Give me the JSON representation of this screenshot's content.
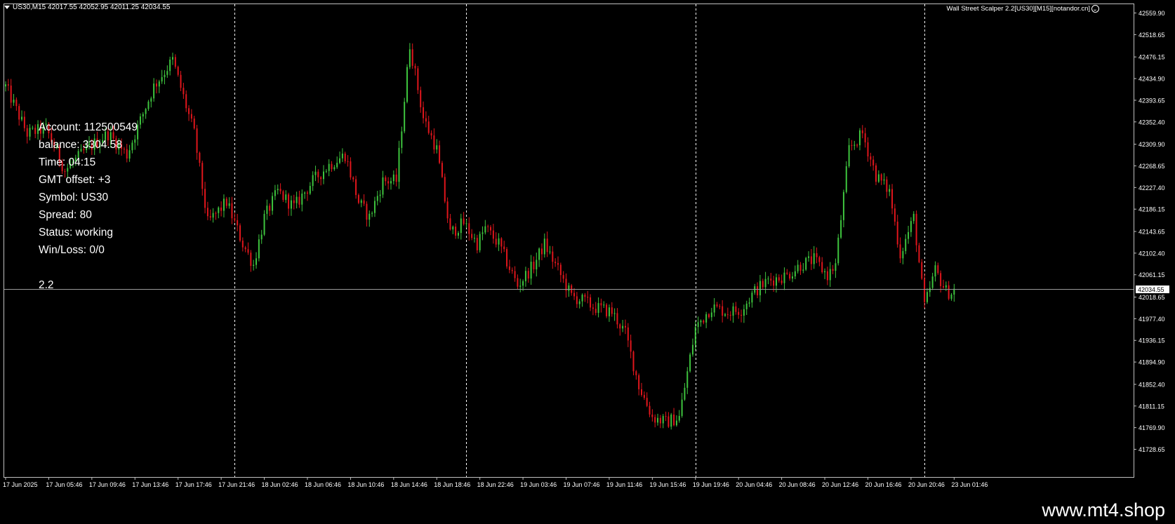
{
  "header": {
    "symbol_info": "US30,M15  42017.55 42052.95 42011.25 42034.55"
  },
  "expert": {
    "label": "Wall Street Scalper 2.2[US30][M15][notandor.cn]"
  },
  "hud": {
    "account": "Account: 112500549",
    "balance": "balance: 3304.58",
    "time": "Time: 04:15",
    "gmt": "GMT offset: +3",
    "symbol": "Symbol: US30",
    "spread": "Spread: 80",
    "status": "Status: working",
    "winloss": "Win/Loss: 0/0",
    "version": "2.2"
  },
  "footer": {
    "brand": "www.mt4.shop"
  },
  "colors": {
    "bull": "#3ec43e",
    "bear": "#e0161c",
    "grid": "#ffffff",
    "background": "#000000"
  },
  "chart_data": {
    "type": "candlestick",
    "ylim": [
      41728.65,
      42559.9
    ],
    "y_ticks": [
      42559.9,
      42518.65,
      42476.15,
      42434.9,
      42393.65,
      42352.4,
      42309.9,
      42268.65,
      42227.4,
      42186.15,
      42143.65,
      42102.4,
      42061.15,
      42018.65,
      41977.4,
      41936.15,
      41894.9,
      41852.4,
      41811.15,
      41769.9,
      41728.65
    ],
    "y_tick_labels": [
      "42559.90",
      "42518.65",
      "42476.15",
      "42434.90",
      "42393.65",
      "42352.40",
      "42309.90",
      "42268.65",
      "42227.40",
      "42186.15",
      "42143.65",
      "42102.40",
      "42061.15",
      "42018.65",
      "41977.40",
      "41936.15",
      "41894.90",
      "41852.40",
      "41811.15",
      "41769.90",
      "41728.65"
    ],
    "current_price": 42034.55,
    "current_price_label": "42034.55",
    "x_tick_labels": [
      "17 Jun 2025",
      "17 Jun 05:46",
      "17 Jun 09:46",
      "17 Jun 13:46",
      "17 Jun 17:46",
      "17 Jun 21:46",
      "18 Jun 02:46",
      "18 Jun 06:46",
      "18 Jun 10:46",
      "18 Jun 14:46",
      "18 Jun 18:46",
      "18 Jun 22:46",
      "19 Jun 03:46",
      "19 Jun 07:46",
      "19 Jun 11:46",
      "19 Jun 15:46",
      "19 Jun 19:46",
      "20 Jun 04:46",
      "20 Jun 08:46",
      "20 Jun 12:46",
      "20 Jun 16:46",
      "20 Jun 20:46",
      "23 Jun 01:46"
    ],
    "bars_total": 448,
    "period_separators": [
      85,
      171,
      256,
      341
    ],
    "anchors": [
      [
        0,
        42420
      ],
      [
        8,
        42330
      ],
      [
        15,
        42340
      ],
      [
        22,
        42260
      ],
      [
        30,
        42300
      ],
      [
        38,
        42330
      ],
      [
        45,
        42290
      ],
      [
        55,
        42420
      ],
      [
        62,
        42470
      ],
      [
        70,
        42330
      ],
      [
        75,
        42160
      ],
      [
        82,
        42200
      ],
      [
        88,
        42120
      ],
      [
        92,
        42080
      ],
      [
        96,
        42170
      ],
      [
        101,
        42220
      ],
      [
        107,
        42190
      ],
      [
        114,
        42240
      ],
      [
        120,
        42270
      ],
      [
        126,
        42290
      ],
      [
        131,
        42200
      ],
      [
        135,
        42170
      ],
      [
        140,
        42240
      ],
      [
        145,
        42240
      ],
      [
        150,
        42500
      ],
      [
        155,
        42360
      ],
      [
        160,
        42300
      ],
      [
        165,
        42140
      ],
      [
        170,
        42160
      ],
      [
        175,
        42120
      ],
      [
        178,
        42150
      ],
      [
        183,
        42120
      ],
      [
        190,
        42040
      ],
      [
        196,
        42080
      ],
      [
        200,
        42120
      ],
      [
        205,
        42070
      ],
      [
        210,
        42020
      ],
      [
        215,
        42010
      ],
      [
        218,
        42000
      ],
      [
        225,
        41990
      ],
      [
        230,
        41950
      ],
      [
        235,
        41850
      ],
      [
        240,
        41790
      ],
      [
        245,
        41780
      ],
      [
        250,
        41790
      ],
      [
        256,
        41960
      ],
      [
        262,
        42000
      ],
      [
        268,
        41990
      ],
      [
        273,
        41995
      ],
      [
        278,
        42030
      ],
      [
        283,
        42050
      ],
      [
        290,
        42060
      ],
      [
        295,
        42080
      ],
      [
        300,
        42090
      ],
      [
        305,
        42060
      ],
      [
        308,
        42080
      ],
      [
        313,
        42300
      ],
      [
        318,
        42330
      ],
      [
        323,
        42250
      ],
      [
        328,
        42220
      ],
      [
        332,
        42100
      ],
      [
        337,
        42170
      ],
      [
        341,
        42000
      ],
      [
        345,
        42070
      ],
      [
        349,
        42030
      ],
      [
        352,
        42025
      ]
    ]
  }
}
